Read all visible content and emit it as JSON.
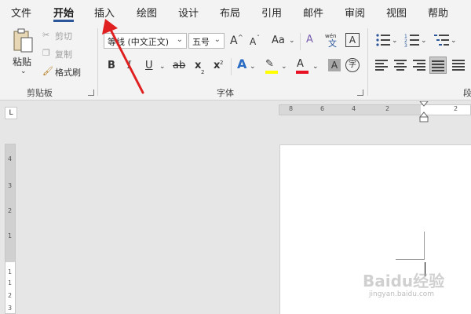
{
  "tabs": [
    "文件",
    "开始",
    "插入",
    "绘图",
    "设计",
    "布局",
    "引用",
    "邮件",
    "审阅",
    "视图",
    "帮助"
  ],
  "clipboard": {
    "paste_label": "粘贴",
    "cut_label": "剪切",
    "copy_label": "复制",
    "format_painter_label": "格式刷",
    "group_label": "剪贴板"
  },
  "font": {
    "font_name": "等线 (中文正文)",
    "font_size": "五号",
    "grow_label": "A",
    "shrink_label": "A",
    "case_label": "Aa",
    "phonetic_label": "wén",
    "phonetic_char": "文",
    "border_label": "A",
    "bold_label": "B",
    "italic_label": "I",
    "underline_label": "U",
    "strike_label": "ab",
    "subscript_label": "x",
    "superscript_label": "x",
    "effects_label": "A",
    "highlight_label": "✎",
    "color_label": "A",
    "shade_label": "A",
    "enclose_label": "字",
    "group_label": "字体",
    "highlight_color": "#ffff00",
    "font_color": "#e81123"
  },
  "paragraph": {
    "group_label": "段"
  },
  "ruler_top_numbers": [
    "8",
    "6",
    "4",
    "2",
    "2"
  ],
  "ruler_left_numbers": [
    "4",
    "3",
    "2",
    "1",
    "1",
    "1",
    "2",
    "3"
  ],
  "corner_label": "L",
  "watermark": {
    "main": "Baidu经验",
    "sub": "jingyan.baidu.com"
  },
  "colors": {
    "accent": "#2b579a",
    "arrow": "#e02020"
  }
}
